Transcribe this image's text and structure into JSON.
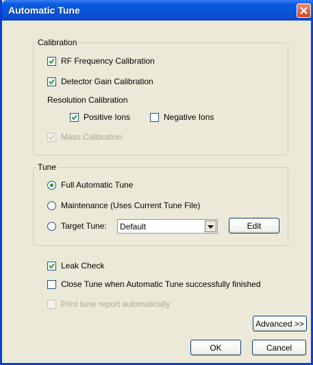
{
  "window": {
    "title": "Automatic Tune"
  },
  "calibration": {
    "legend": "Calibration",
    "rf_frequency": "RF Frequency Calibration",
    "detector_gain": "Detector Gain Calibration",
    "resolution_heading": "Resolution Calibration",
    "positive_ions": "Positive Ions",
    "negative_ions": "Negative Ions",
    "mass_calibration": "Mass Calibration"
  },
  "tune": {
    "legend": "Tune",
    "full_automatic": "Full Automatic Tune",
    "maintenance": "Maintenance (Uses Current Tune File)",
    "target_tune": "Target Tune:",
    "target_value": "Default",
    "edit_label": "Edit"
  },
  "options": {
    "leak_check": "Leak Check",
    "close_tune": "Close Tune when Automatic Tune successfully finished",
    "print_report": "Print tune report automatically"
  },
  "buttons": {
    "advanced": "Advanced >>",
    "ok": "OK",
    "cancel": "Cancel"
  },
  "colors": {
    "titlebar": "#0a55d8",
    "close": "#d0482a",
    "radio_dot": "#21a121",
    "dialog_bg": "#ece9d8"
  }
}
